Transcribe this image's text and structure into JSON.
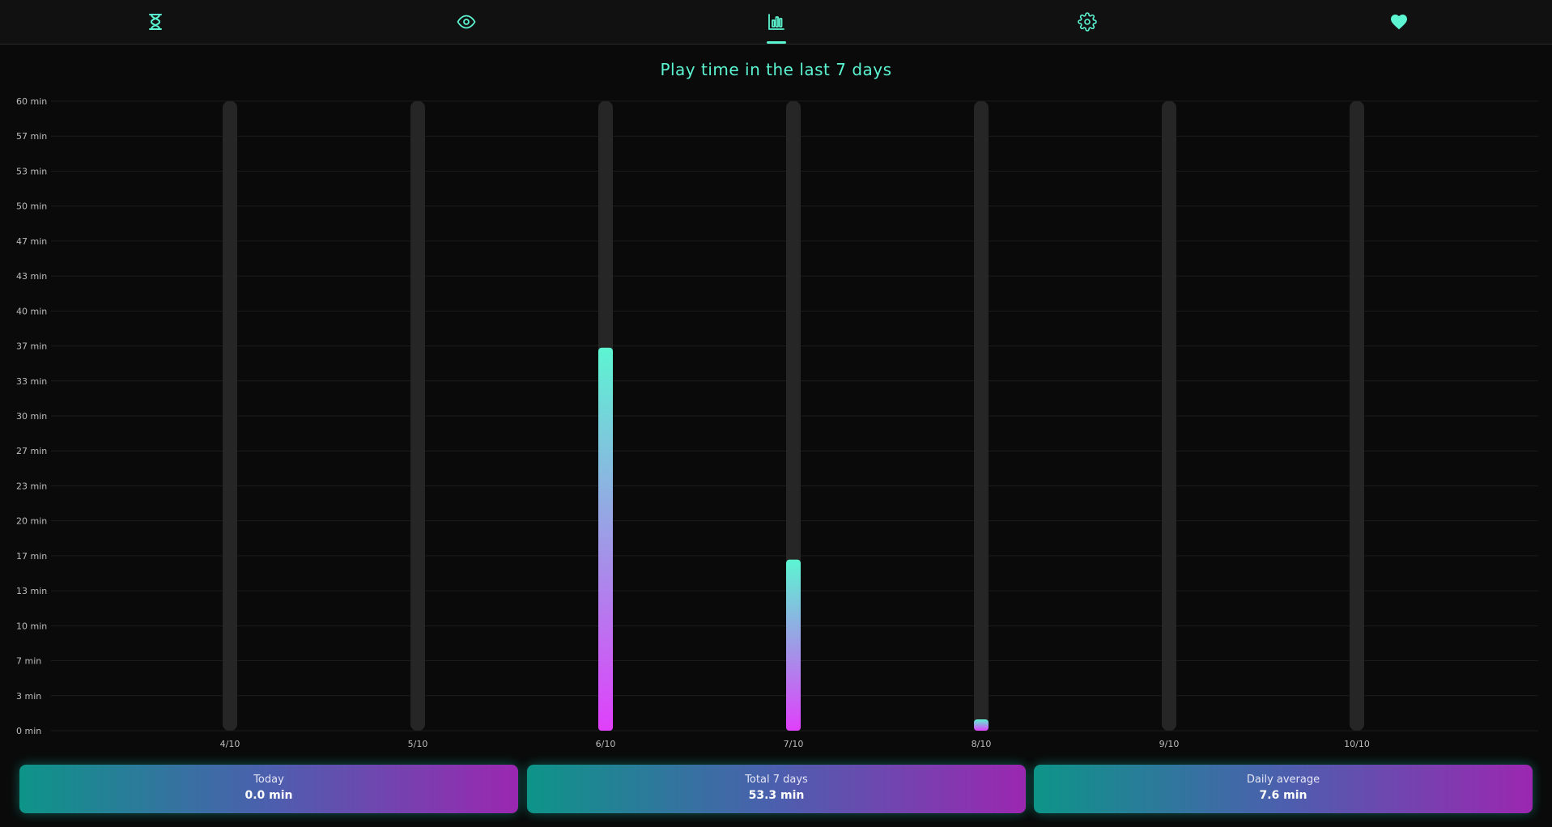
{
  "colors": {
    "accent": "#5cf5d2",
    "bar_top": "#5cf5d2",
    "bar_bottom": "#e040fb",
    "track": "#262626",
    "grid": "#1c1c1c",
    "tick_text": "#bdbdbd"
  },
  "nav": {
    "items": [
      {
        "icon": "hourglass-icon",
        "active": false
      },
      {
        "icon": "eye-icon",
        "active": false
      },
      {
        "icon": "bar-chart-icon",
        "active": true
      },
      {
        "icon": "gear-icon",
        "active": false
      },
      {
        "icon": "heart-icon",
        "active": false
      }
    ]
  },
  "chart_data": {
    "type": "bar",
    "title": "Play time in the last 7 days",
    "categories": [
      "4/10",
      "5/10",
      "6/10",
      "7/10",
      "8/10",
      "9/10",
      "10/10"
    ],
    "values": [
      0,
      0,
      36.5,
      16.3,
      1,
      0,
      0
    ],
    "unit": "min",
    "ylim": [
      0,
      60
    ],
    "yticks": [
      "0 min",
      "3 min",
      "7 min",
      "10 min",
      "13 min",
      "17 min",
      "20 min",
      "23 min",
      "27 min",
      "30 min",
      "33 min",
      "37 min",
      "40 min",
      "43 min",
      "47 min",
      "50 min",
      "53 min",
      "57 min",
      "60 min"
    ],
    "grid": true,
    "legend": "none"
  },
  "summary": {
    "today_label": "Today",
    "today_value": "0.0 min",
    "total_label": "Total 7 days",
    "total_value": "53.3 min",
    "avg_label": "Daily average",
    "avg_value": "7.6 min"
  }
}
